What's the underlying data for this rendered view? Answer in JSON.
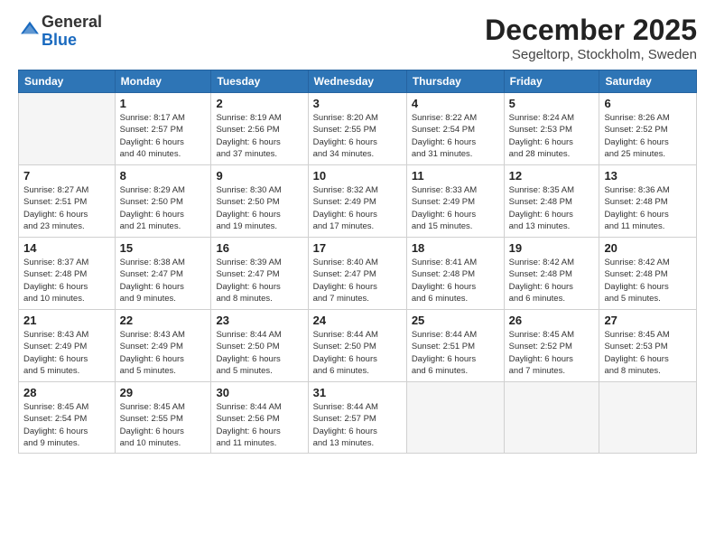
{
  "logo": {
    "general": "General",
    "blue": "Blue"
  },
  "header": {
    "month": "December 2025",
    "location": "Segeltorp, Stockholm, Sweden"
  },
  "weekdays": [
    "Sunday",
    "Monday",
    "Tuesday",
    "Wednesday",
    "Thursday",
    "Friday",
    "Saturday"
  ],
  "weeks": [
    [
      {
        "day": "",
        "info": ""
      },
      {
        "day": "1",
        "info": "Sunrise: 8:17 AM\nSunset: 2:57 PM\nDaylight: 6 hours\nand 40 minutes."
      },
      {
        "day": "2",
        "info": "Sunrise: 8:19 AM\nSunset: 2:56 PM\nDaylight: 6 hours\nand 37 minutes."
      },
      {
        "day": "3",
        "info": "Sunrise: 8:20 AM\nSunset: 2:55 PM\nDaylight: 6 hours\nand 34 minutes."
      },
      {
        "day": "4",
        "info": "Sunrise: 8:22 AM\nSunset: 2:54 PM\nDaylight: 6 hours\nand 31 minutes."
      },
      {
        "day": "5",
        "info": "Sunrise: 8:24 AM\nSunset: 2:53 PM\nDaylight: 6 hours\nand 28 minutes."
      },
      {
        "day": "6",
        "info": "Sunrise: 8:26 AM\nSunset: 2:52 PM\nDaylight: 6 hours\nand 25 minutes."
      }
    ],
    [
      {
        "day": "7",
        "info": "Sunrise: 8:27 AM\nSunset: 2:51 PM\nDaylight: 6 hours\nand 23 minutes."
      },
      {
        "day": "8",
        "info": "Sunrise: 8:29 AM\nSunset: 2:50 PM\nDaylight: 6 hours\nand 21 minutes."
      },
      {
        "day": "9",
        "info": "Sunrise: 8:30 AM\nSunset: 2:50 PM\nDaylight: 6 hours\nand 19 minutes."
      },
      {
        "day": "10",
        "info": "Sunrise: 8:32 AM\nSunset: 2:49 PM\nDaylight: 6 hours\nand 17 minutes."
      },
      {
        "day": "11",
        "info": "Sunrise: 8:33 AM\nSunset: 2:49 PM\nDaylight: 6 hours\nand 15 minutes."
      },
      {
        "day": "12",
        "info": "Sunrise: 8:35 AM\nSunset: 2:48 PM\nDaylight: 6 hours\nand 13 minutes."
      },
      {
        "day": "13",
        "info": "Sunrise: 8:36 AM\nSunset: 2:48 PM\nDaylight: 6 hours\nand 11 minutes."
      }
    ],
    [
      {
        "day": "14",
        "info": "Sunrise: 8:37 AM\nSunset: 2:48 PM\nDaylight: 6 hours\nand 10 minutes."
      },
      {
        "day": "15",
        "info": "Sunrise: 8:38 AM\nSunset: 2:47 PM\nDaylight: 6 hours\nand 9 minutes."
      },
      {
        "day": "16",
        "info": "Sunrise: 8:39 AM\nSunset: 2:47 PM\nDaylight: 6 hours\nand 8 minutes."
      },
      {
        "day": "17",
        "info": "Sunrise: 8:40 AM\nSunset: 2:47 PM\nDaylight: 6 hours\nand 7 minutes."
      },
      {
        "day": "18",
        "info": "Sunrise: 8:41 AM\nSunset: 2:48 PM\nDaylight: 6 hours\nand 6 minutes."
      },
      {
        "day": "19",
        "info": "Sunrise: 8:42 AM\nSunset: 2:48 PM\nDaylight: 6 hours\nand 6 minutes."
      },
      {
        "day": "20",
        "info": "Sunrise: 8:42 AM\nSunset: 2:48 PM\nDaylight: 6 hours\nand 5 minutes."
      }
    ],
    [
      {
        "day": "21",
        "info": "Sunrise: 8:43 AM\nSunset: 2:49 PM\nDaylight: 6 hours\nand 5 minutes."
      },
      {
        "day": "22",
        "info": "Sunrise: 8:43 AM\nSunset: 2:49 PM\nDaylight: 6 hours\nand 5 minutes."
      },
      {
        "day": "23",
        "info": "Sunrise: 8:44 AM\nSunset: 2:50 PM\nDaylight: 6 hours\nand 5 minutes."
      },
      {
        "day": "24",
        "info": "Sunrise: 8:44 AM\nSunset: 2:50 PM\nDaylight: 6 hours\nand 6 minutes."
      },
      {
        "day": "25",
        "info": "Sunrise: 8:44 AM\nSunset: 2:51 PM\nDaylight: 6 hours\nand 6 minutes."
      },
      {
        "day": "26",
        "info": "Sunrise: 8:45 AM\nSunset: 2:52 PM\nDaylight: 6 hours\nand 7 minutes."
      },
      {
        "day": "27",
        "info": "Sunrise: 8:45 AM\nSunset: 2:53 PM\nDaylight: 6 hours\nand 8 minutes."
      }
    ],
    [
      {
        "day": "28",
        "info": "Sunrise: 8:45 AM\nSunset: 2:54 PM\nDaylight: 6 hours\nand 9 minutes."
      },
      {
        "day": "29",
        "info": "Sunrise: 8:45 AM\nSunset: 2:55 PM\nDaylight: 6 hours\nand 10 minutes."
      },
      {
        "day": "30",
        "info": "Sunrise: 8:44 AM\nSunset: 2:56 PM\nDaylight: 6 hours\nand 11 minutes."
      },
      {
        "day": "31",
        "info": "Sunrise: 8:44 AM\nSunset: 2:57 PM\nDaylight: 6 hours\nand 13 minutes."
      },
      {
        "day": "",
        "info": ""
      },
      {
        "day": "",
        "info": ""
      },
      {
        "day": "",
        "info": ""
      }
    ]
  ]
}
